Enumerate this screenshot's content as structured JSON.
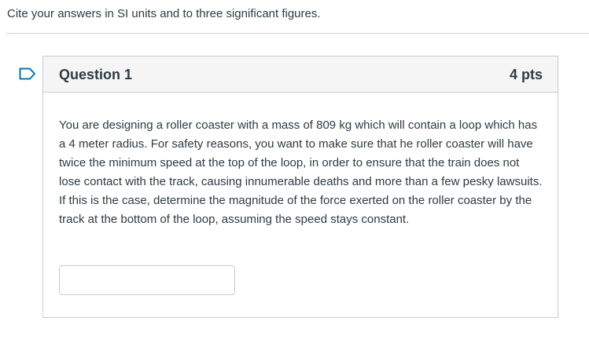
{
  "instructions": "Cite your answers in SI units and to three significant figures.",
  "question": {
    "title": "Question 1",
    "points": "4 pts",
    "text": "You are designing a roller coaster with a mass of 809 kg which will contain a loop which has a 4 meter radius.  For safety reasons, you want to make sure that he roller coaster will have twice the minimum speed at the top of the loop, in order to ensure that the train does not lose contact with the track, causing innumerable deaths and more than a few pesky lawsuits.  If this is the case, determine the magnitude of the force exerted on the roller coaster by the track at the bottom of the loop, assuming the speed stays constant.",
    "answer_value": ""
  },
  "colors": {
    "flag": "#0374b5",
    "border": "#c7cdd1",
    "header_bg": "#f5f5f5",
    "text": "#2d3b45"
  },
  "icons": {
    "flag": "flag-icon"
  }
}
